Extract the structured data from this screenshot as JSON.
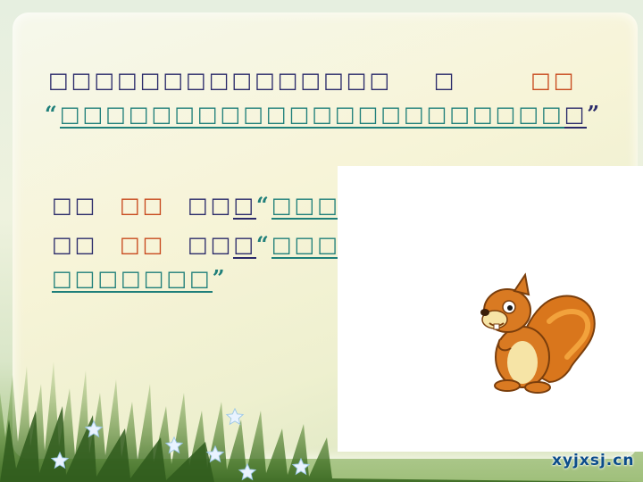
{
  "line1": {
    "text": "□□□□□□□□□□□□□□□",
    "mid": "□",
    "red": "□□"
  },
  "line2": {
    "open_quote": "“",
    "text": "□□□□□□□□□□□□□□□□□□□□□□",
    "tail": "□",
    "close_quote": "”"
  },
  "line3": {
    "a": "□□",
    "red": "□□",
    "b": "□□",
    "b_ul": "□",
    "open_quote": "“",
    "c": "□□□□□"
  },
  "line4": {
    "a": "□□",
    "red": "□□",
    "b": "□□",
    "b_ul": "□",
    "open_quote": "“",
    "c": "□□□□□"
  },
  "line5": {
    "text": "□□□□□□□",
    "close_quote": "”"
  },
  "watermark": "xyjxsj.cn",
  "colors": {
    "text_dark": "#2a2a6a",
    "text_red": "#c84a1e",
    "underline_teal": "#1f7f7a"
  },
  "icons": [
    "squirrel-illustration",
    "star-icon"
  ]
}
